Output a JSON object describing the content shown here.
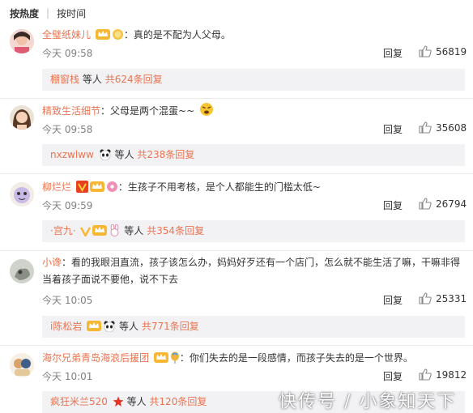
{
  "sort_tabs": {
    "hot": "按热度",
    "time": "按时间"
  },
  "colors": {
    "username": "#eb7350",
    "time": "#808080",
    "subbox_bg": "#f2f2f5"
  },
  "ui": {
    "reply": "回复",
    "people_suffix": "等人",
    "total_prefix": "共",
    "total_suffix": "条回复"
  },
  "comments": [
    {
      "user": "全璧纸妹儿",
      "text": "真的是不配为人父母。",
      "time": "今天 09:58",
      "likes": "56819",
      "reply_users": "棚窗栈",
      "reply_count": "624",
      "badges": [
        "vip-crown-icon",
        "medal-icon"
      ]
    },
    {
      "user": "精致生活细节",
      "text": "父母是两个混蛋~~",
      "time": "今天 09:58",
      "likes": "35608",
      "reply_users": "nxzwlww",
      "reply_count": "238",
      "badges": []
    },
    {
      "user": "柳烂烂",
      "text": "生孩子不用考核，是个人都能生的门槛太低~",
      "time": "今天 09:59",
      "likes": "26794",
      "reply_users": "·宫九·",
      "reply_count": "354",
      "badges": [
        "v-badge-icon",
        "vip-crown-icon",
        "donut-icon"
      ]
    },
    {
      "user": "小谗",
      "text": "看的我眼泪直流，孩子该怎么办，妈妈好歹还有一个店门，怎么就不能生活了嘛，干嘛非得当着孩子面说不要他，说不下去",
      "time": "今天 10:05",
      "likes": "25331",
      "reply_users": "i陈松岩",
      "reply_count": "771",
      "badges": []
    },
    {
      "user": "海尔兄弟青岛海浪后援团",
      "text": "你们失去的是一段感情，而孩子失去的是一个世界。",
      "time": "今天 10:01",
      "likes": "19812",
      "reply_users": "疯狂米兰520",
      "reply_count": "120",
      "badges": [
        "vip-crown-icon",
        "balloon-icon"
      ]
    }
  ],
  "watermark": "快传号 / 小象知天下"
}
